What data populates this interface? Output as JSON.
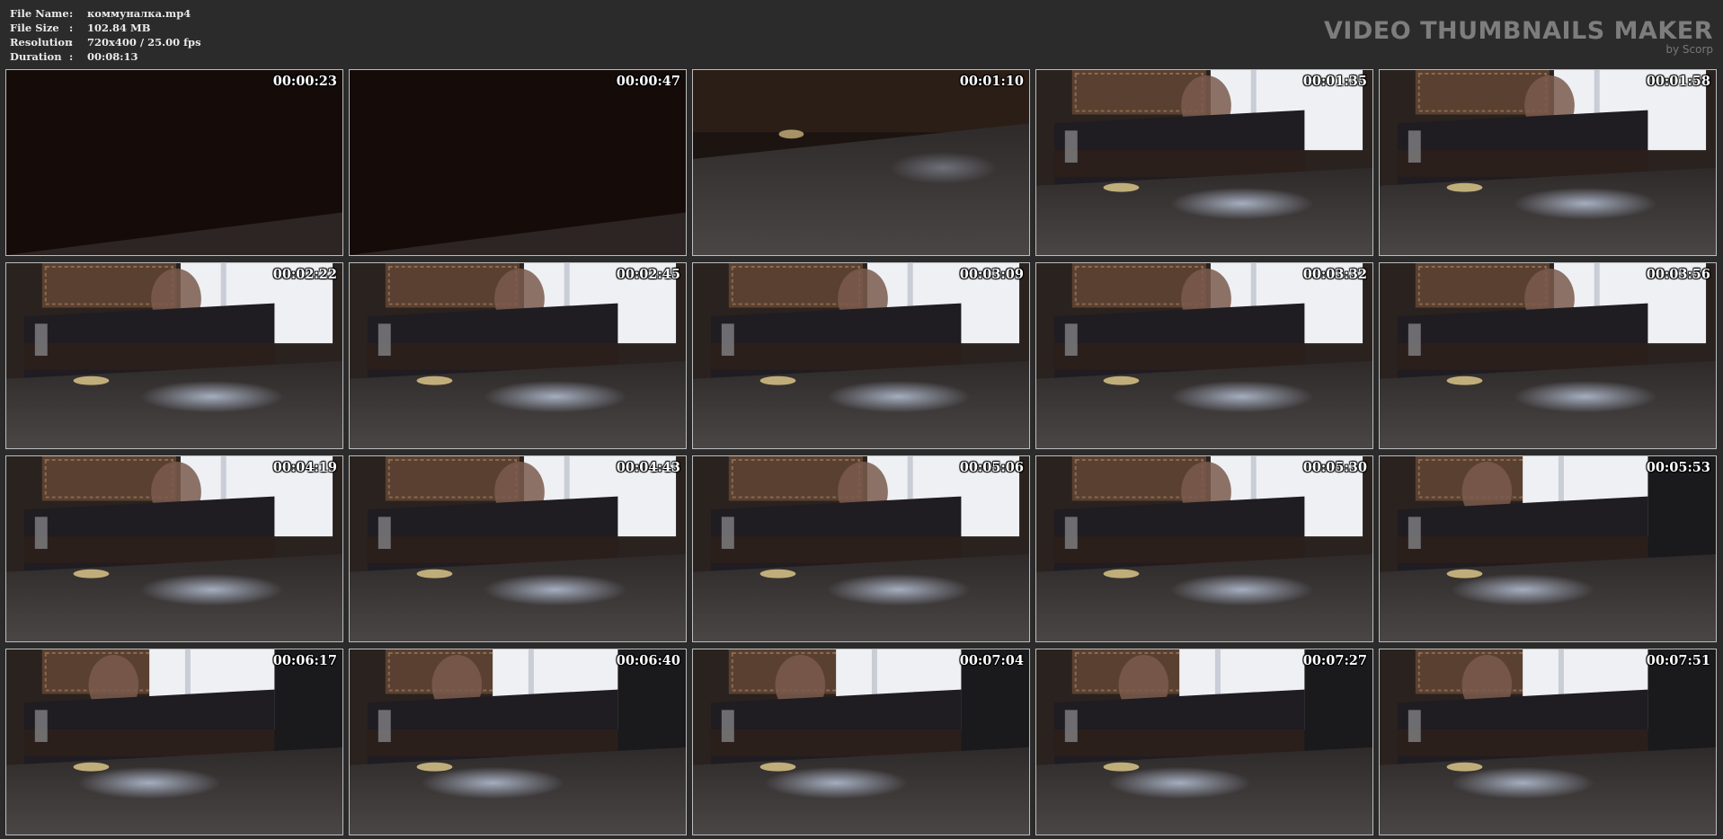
{
  "info": {
    "rows": [
      {
        "label": "File Name",
        "sep": ":",
        "value": "коммуналка.mp4"
      },
      {
        "label": "File Size",
        "sep": ":",
        "value": "102.84 MB"
      },
      {
        "label": "Resolution",
        "sep": ":",
        "value": "720x400 / 25.00 fps"
      },
      {
        "label": "Duration",
        "sep": ":",
        "value": "00:08:13"
      }
    ]
  },
  "brand": {
    "title": "VIDEO THUMBNAILS MAKER",
    "subtitle": "by Scorp"
  },
  "thumbnails": [
    {
      "time": "00:00:23",
      "scene": "dark"
    },
    {
      "time": "00:00:47",
      "scene": "dark"
    },
    {
      "time": "00:01:10",
      "scene": "dim"
    },
    {
      "time": "00:01:35",
      "scene": "room"
    },
    {
      "time": "00:01:58",
      "scene": "room"
    },
    {
      "time": "00:02:22",
      "scene": "room"
    },
    {
      "time": "00:02:45",
      "scene": "room"
    },
    {
      "time": "00:03:09",
      "scene": "room"
    },
    {
      "time": "00:03:32",
      "scene": "room"
    },
    {
      "time": "00:03:56",
      "scene": "room"
    },
    {
      "time": "00:04:19",
      "scene": "room"
    },
    {
      "time": "00:04:43",
      "scene": "room"
    },
    {
      "time": "00:05:06",
      "scene": "room"
    },
    {
      "time": "00:05:30",
      "scene": "room"
    },
    {
      "time": "00:05:53",
      "scene": "room-door"
    },
    {
      "time": "00:06:17",
      "scene": "room-door"
    },
    {
      "time": "00:06:40",
      "scene": "room-door"
    },
    {
      "time": "00:07:04",
      "scene": "room-door"
    },
    {
      "time": "00:07:27",
      "scene": "room-door"
    },
    {
      "time": "00:07:51",
      "scene": "room-door"
    }
  ]
}
